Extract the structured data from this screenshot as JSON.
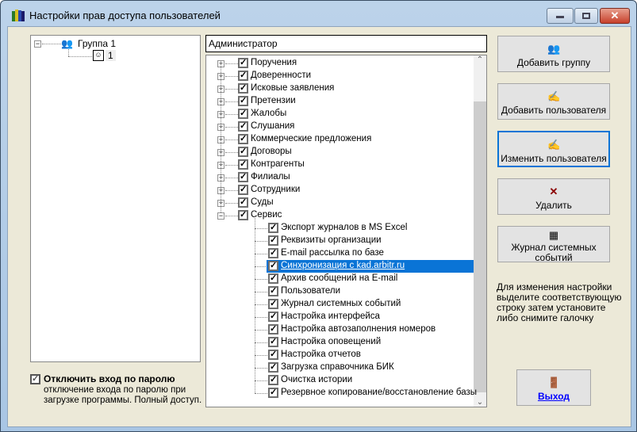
{
  "window": {
    "title": "Настройки прав доступа пользователей",
    "minimize": "minimize",
    "maximize": "maximize",
    "close": "✕"
  },
  "groups_tree": {
    "group": "Группа 1",
    "user": "1"
  },
  "user_name": "Администратор",
  "permissions": [
    {
      "label": "Поручения",
      "checked": true
    },
    {
      "label": "Доверенности",
      "checked": true
    },
    {
      "label": "Исковые заявления",
      "checked": true
    },
    {
      "label": "Претензии",
      "checked": true
    },
    {
      "label": "Жалобы",
      "checked": true
    },
    {
      "label": "Слушания",
      "checked": true
    },
    {
      "label": "Коммерческие предложения",
      "checked": true
    },
    {
      "label": "Договоры",
      "checked": true
    },
    {
      "label": "Контрагенты",
      "checked": true
    },
    {
      "label": "Филиалы",
      "checked": true
    },
    {
      "label": "Сотрудники",
      "checked": true
    },
    {
      "label": "Суды",
      "checked": true
    },
    {
      "label": "Сервис",
      "checked": true,
      "expanded": true,
      "children": [
        "Экспорт журналов в MS Excel",
        "Реквизиты организации",
        "E-mail рассылка по базе",
        "Синхронизация с kad.arbitr.ru",
        "Архив сообщений на E-mail",
        "Пользователи",
        "Журнал системных событий",
        "Настройка интерфейса",
        "Настройка автозаполнения номеров",
        "Настройка оповещений",
        "Настройка отчетов",
        "Загрузка справочника БИК",
        "Очистка истории",
        "Резервное копирование/восстановление базы"
      ]
    }
  ],
  "selected_child": 3,
  "buttons": {
    "add_group": "Добавить группу",
    "add_user": "Добавить пользователя",
    "edit_user": "Изменить пользователя",
    "delete": "Удалить",
    "log1": "Журнал системных",
    "log2": "событий",
    "exit": "Выход"
  },
  "help_text": [
    "Для изменения настройки",
    "выделите соответствующую",
    "строку затем установите",
    "либо снимите галочку"
  ],
  "password": {
    "label": "Отключить вход по паролю",
    "desc1": "отключение входа по паролю при",
    "desc2": "загрузке программы. Полный доступ.",
    "checked": true
  },
  "colors": {
    "selection": "#0a74d6",
    "background": "#ece9d8"
  }
}
